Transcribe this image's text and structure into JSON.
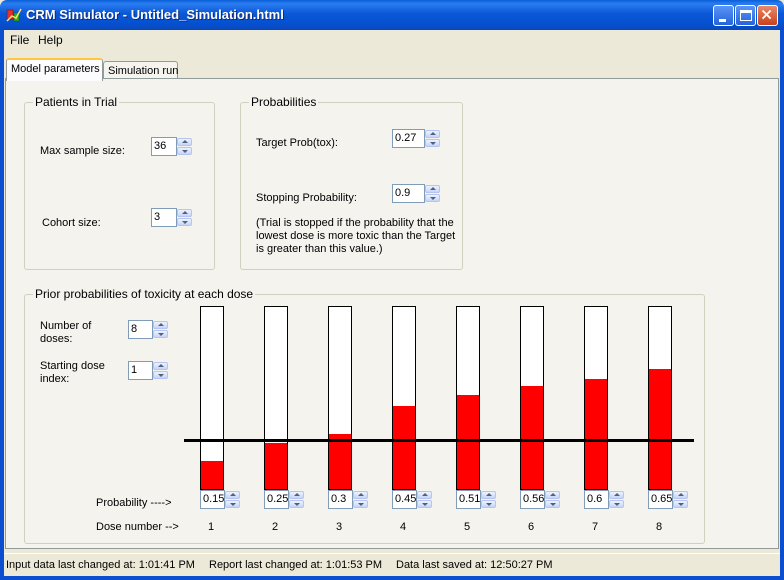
{
  "window": {
    "title": "CRM Simulator - Untitled_Simulation.html"
  },
  "menu": {
    "file": "File",
    "help": "Help"
  },
  "tabs": [
    {
      "label": "Model parameters",
      "active": true
    },
    {
      "label": "Simulation run",
      "active": false
    }
  ],
  "patients": {
    "title": "Patients in Trial",
    "max_sample_label": "Max sample size:",
    "max_sample_value": "36",
    "cohort_label": "Cohort size:",
    "cohort_value": "3"
  },
  "probabilities": {
    "title": "Probabilities",
    "target_label": "Target Prob(tox):",
    "target_value": "0.27",
    "stopping_label": "Stopping Probability:",
    "stopping_value": "0.9",
    "note": "(Trial is stopped if the probability that the lowest dose is more toxic than the Target is greater than this value.)"
  },
  "priors": {
    "title": "Prior probabilities of toxicity at each dose",
    "num_doses_label": "Number of doses:",
    "num_doses_value": "8",
    "start_dose_label": "Starting dose index:",
    "start_dose_value": "1",
    "probability_row_label": "Probability  ---->",
    "dose_number_row_label": "Dose number -->",
    "target": 0.27,
    "bar_fill_color": "#ff0000",
    "doses": [
      {
        "number": "1",
        "probability": "0.15"
      },
      {
        "number": "2",
        "probability": "0.25"
      },
      {
        "number": "3",
        "probability": "0.3"
      },
      {
        "number": "4",
        "probability": "0.45"
      },
      {
        "number": "5",
        "probability": "0.51"
      },
      {
        "number": "6",
        "probability": "0.56"
      },
      {
        "number": "7",
        "probability": "0.6"
      },
      {
        "number": "8",
        "probability": "0.65"
      }
    ]
  },
  "status": {
    "input_changed": "Input data last changed at: 1:01:41 PM",
    "report_changed": "Report last changed at: 1:01:53 PM",
    "last_saved": "Data last saved at: 12:50:27 PM"
  }
}
